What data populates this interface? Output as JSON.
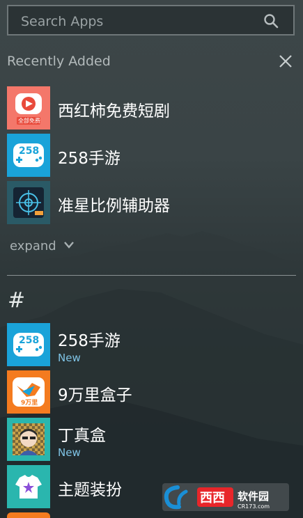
{
  "search": {
    "placeholder": "Search Apps",
    "icon": "search-icon"
  },
  "recent": {
    "title": "Recently Added",
    "close_icon": "close-icon",
    "items": [
      {
        "label": "西红柿免费短剧",
        "icon": "tomato-drama-app-icon",
        "icon_color": "#f4776a",
        "icon_caption": "全部免费"
      },
      {
        "label": "258手游",
        "icon": "258-game-app-icon",
        "icon_color": "#1aa3d9",
        "icon_caption": "258"
      },
      {
        "label": "准星比例辅助器",
        "icon": "crosshair-app-icon",
        "icon_color": "#152433"
      }
    ],
    "expand_label": "expand"
  },
  "section": {
    "header": "#",
    "items": [
      {
        "label": "258手游",
        "badge": "New",
        "icon": "258-game-app-icon",
        "icon_color": "#1aa3d9",
        "icon_caption": "258"
      },
      {
        "label": "9万里盒子",
        "badge": "",
        "icon": "9wanli-box-app-icon",
        "icon_color": "#f47b1f",
        "icon_caption": "9万里"
      },
      {
        "label": "丁真盒",
        "badge": "New",
        "icon": "dingzhen-box-app-icon",
        "icon_color": "#c9a24a"
      },
      {
        "label": "主题装扮",
        "badge": "",
        "icon": "theme-app-icon",
        "icon_color": "#2ab6ae"
      }
    ]
  },
  "watermark": {
    "text": "CR173.com",
    "brand": "西西软件园"
  }
}
